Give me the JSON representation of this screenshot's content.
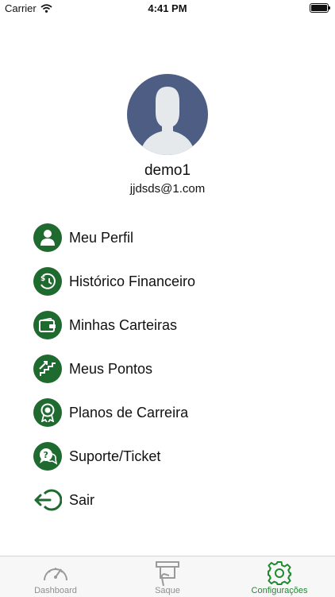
{
  "status_bar": {
    "carrier": "Carrier",
    "time": "4:41 PM"
  },
  "profile": {
    "name": "demo1",
    "email": "jjdsds@1.com"
  },
  "menu": [
    {
      "label": "Meu Perfil",
      "icon": "person-icon"
    },
    {
      "label": "Histórico Financeiro",
      "icon": "money-history-icon"
    },
    {
      "label": "Minhas Carteiras",
      "icon": "wallet-icon"
    },
    {
      "label": "Meus Pontos",
      "icon": "stairs-growth-icon"
    },
    {
      "label": "Planos de Carreira",
      "icon": "award-ribbon-icon"
    },
    {
      "label": "Suporte/Ticket",
      "icon": "support-chat-icon"
    },
    {
      "label": "Sair",
      "icon": "logout-icon"
    }
  ],
  "tabs": [
    {
      "label": "Dashboard",
      "icon": "speedometer-icon",
      "active": false
    },
    {
      "label": "Saque",
      "icon": "atm-withdraw-icon",
      "active": false
    },
    {
      "label": "Configurações",
      "icon": "gear-icon",
      "active": true
    }
  ],
  "colors": {
    "accent": "#1e6a2f",
    "tab_active": "#1e8a2f",
    "tab_inactive": "#8f8f8f",
    "avatar_bg": "#4d5d84"
  }
}
